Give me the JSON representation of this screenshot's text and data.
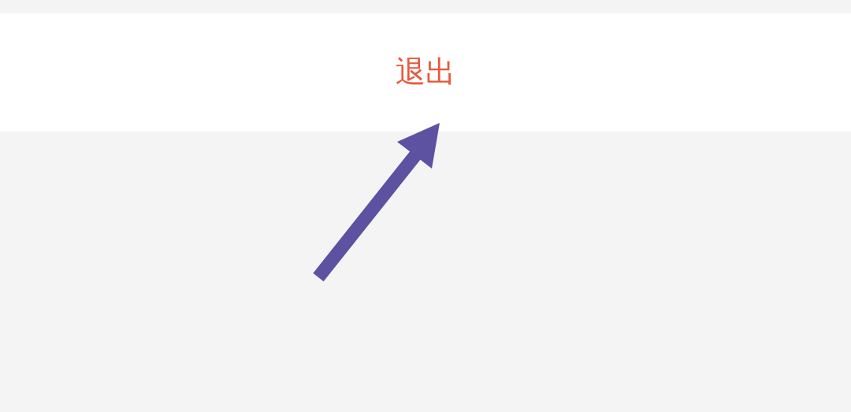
{
  "logout_button": {
    "label": "退出"
  }
}
